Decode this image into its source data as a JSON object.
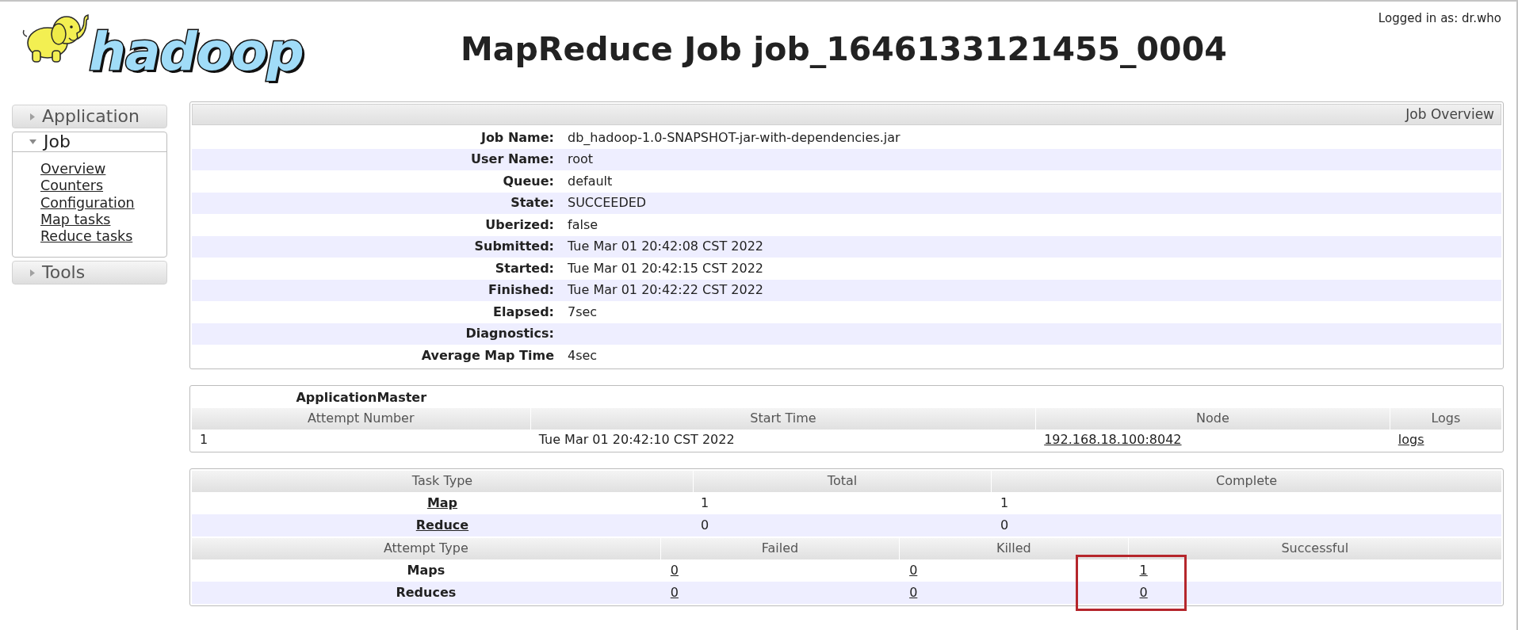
{
  "header": {
    "logo_text": "hadoop",
    "title": "MapReduce Job job_1646133121455_0004",
    "login": "Logged in as: dr.who"
  },
  "sidebar": [
    {
      "label": "Application",
      "expanded": false
    },
    {
      "label": "Job",
      "expanded": true,
      "links": [
        "Overview",
        "Counters",
        "Configuration",
        "Map tasks",
        "Reduce tasks"
      ]
    },
    {
      "label": "Tools",
      "expanded": false
    }
  ],
  "job_overview": {
    "title": "Job Overview",
    "rows": [
      {
        "label": "Job Name:",
        "value": "db_hadoop-1.0-SNAPSHOT-jar-with-dependencies.jar"
      },
      {
        "label": "User Name:",
        "value": "root"
      },
      {
        "label": "Queue:",
        "value": "default"
      },
      {
        "label": "State:",
        "value": "SUCCEEDED"
      },
      {
        "label": "Uberized:",
        "value": "false"
      },
      {
        "label": "Submitted:",
        "value": "Tue Mar 01 20:42:08 CST 2022"
      },
      {
        "label": "Started:",
        "value": "Tue Mar 01 20:42:15 CST 2022"
      },
      {
        "label": "Finished:",
        "value": "Tue Mar 01 20:42:22 CST 2022"
      },
      {
        "label": "Elapsed:",
        "value": "7sec"
      },
      {
        "label": "Diagnostics:"
      },
      {
        "label": "Average Map Time",
        "value": "4sec"
      }
    ]
  },
  "application_master": {
    "title": "ApplicationMaster",
    "columns": [
      "Attempt Number",
      "Start Time",
      "Node",
      "Logs"
    ],
    "rows": [
      {
        "attempt_number": "1",
        "start_time": "Tue Mar 01 20:42:10 CST 2022",
        "node": "192.168.18.100:8042",
        "logs": "logs"
      }
    ]
  },
  "tasks": {
    "columns": [
      "Task Type",
      "Total",
      "Complete"
    ],
    "rows": [
      {
        "task_type": "Map",
        "total": "1",
        "complete": "1"
      },
      {
        "task_type": "Reduce",
        "total": "0",
        "complete": "0"
      }
    ]
  },
  "attempts": {
    "columns": [
      "Attempt Type",
      "Failed",
      "Killed",
      "Successful"
    ],
    "rows": [
      {
        "attempt_type": "Maps",
        "failed": "0",
        "killed": "0",
        "successful": "1"
      },
      {
        "attempt_type": "Reduces",
        "failed": "0",
        "killed": "0",
        "successful": "0"
      }
    ]
  }
}
